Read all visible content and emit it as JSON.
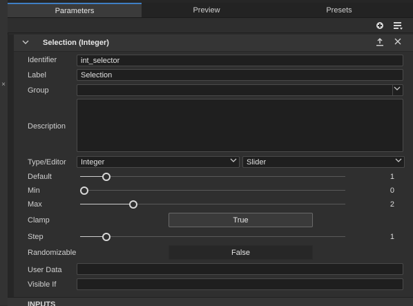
{
  "tabs": [
    {
      "label": "Parameters",
      "active": true
    },
    {
      "label": "Preview",
      "active": false
    },
    {
      "label": "Presets",
      "active": false
    }
  ],
  "toolbar": {
    "icons": [
      "add-icon",
      "menu-icon"
    ]
  },
  "section": {
    "title": "Selection (Integer)",
    "icons": [
      "chevron-down-icon",
      "export-icon",
      "close-icon"
    ]
  },
  "fields": {
    "identifier": {
      "label": "Identifier",
      "value": "int_selector"
    },
    "label": {
      "label": "Label",
      "value": "Selection"
    },
    "group": {
      "label": "Group",
      "value": ""
    },
    "description": {
      "label": "Description",
      "value": ""
    },
    "type_editor": {
      "label": "Type/Editor",
      "type": "Integer",
      "editor": "Slider"
    },
    "default": {
      "label": "Default",
      "value": "1",
      "fraction": 0.1
    },
    "min": {
      "label": "Min",
      "value": "0",
      "fraction": 0.0
    },
    "max": {
      "label": "Max",
      "value": "2",
      "fraction": 0.2
    },
    "clamp": {
      "label": "Clamp",
      "value": "True"
    },
    "step": {
      "label": "Step",
      "value": "1",
      "fraction": 0.1
    },
    "randomizable": {
      "label": "Randomizable",
      "value": "False"
    },
    "user_data": {
      "label": "User Data",
      "value": ""
    },
    "visible_if": {
      "label": "Visible If",
      "value": ""
    }
  },
  "bottom_section": {
    "title": "INPUTS"
  },
  "colors": {
    "accent": "#3f7fc5",
    "background": "#2b2b2b",
    "field_bg": "#1f1f1f"
  }
}
